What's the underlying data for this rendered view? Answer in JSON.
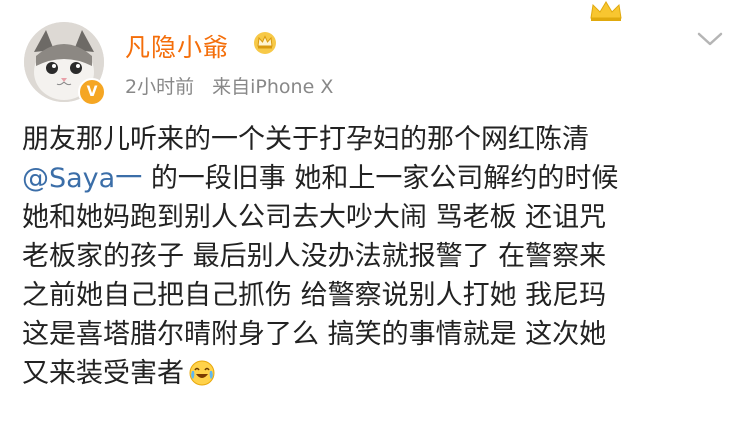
{
  "post": {
    "username": "凡隐小爺",
    "time": "2小时前",
    "source": "来自iPhone X",
    "lines": [
      "朋友那儿听来的一个关于打孕妇的那个网红陈清",
      "的一段旧事 她和上一家公司解约的时候",
      "她和她妈跑到别人公司去大吵大闹 骂老板 还诅咒",
      "老板家的孩子 最后别人没办法就报警了 在警察来",
      "之前她自己把自己抓伤 给警察说别人打她 我尼玛",
      "这是喜塔腊尔晴附身了么 搞笑的事情就是 这次她",
      "又来装受害者"
    ],
    "mention": "@Saya一",
    "verified_mark": "V",
    "colors": {
      "username": "#f46e0a",
      "mention": "#3b6ea8",
      "meta": "#888888",
      "text": "#222222"
    },
    "icons": [
      "cat-avatar",
      "verified-badge",
      "crown-badge-icon",
      "crown-icon",
      "chevron-down-icon",
      "laugh-cry-emoji-icon"
    ]
  }
}
